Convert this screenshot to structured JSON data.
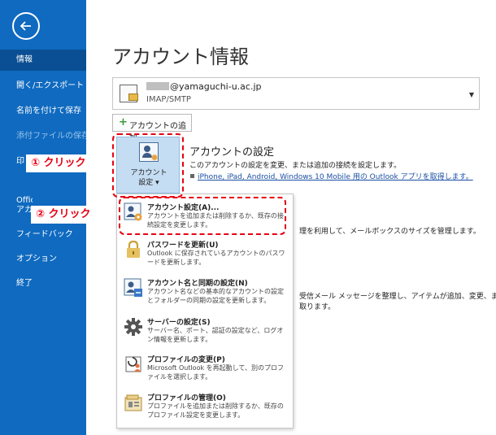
{
  "sidebar": {
    "items": [
      {
        "label": "情報",
        "state": "active"
      },
      {
        "label": "開く/エクスポート"
      },
      {
        "label": "名前を付けて保存"
      },
      {
        "label": "添付ファイルの保存",
        "state": "disabled"
      },
      {
        "label": "印"
      },
      {
        "label": "Office アカ"
      },
      {
        "label": "フィードバック"
      },
      {
        "label": "オプション"
      },
      {
        "label": "終了"
      }
    ]
  },
  "page": {
    "title": "アカウント情報"
  },
  "account": {
    "email": "@yamaguchi-u.ac.jp",
    "type": "IMAP/SMTP"
  },
  "add_account": {
    "label": "アカウントの追加"
  },
  "settings_tile": {
    "label_line1": "アカウント",
    "label_line2": "設定 ▾"
  },
  "section": {
    "title": "アカウントの設定",
    "description": "このアカウントの設定を変更、または追加の接続を設定します。",
    "link": "iPhone, iPad, Android, Windows 10 Mobile 用の Outlook アプリを取得します。"
  },
  "background_text": {
    "line1": "理を利用して、メールボックスのサイズを管理します。",
    "line2": "受信メール メッセージを整理し、アイテムが追加、変更、また",
    "line3": "取ります。"
  },
  "menu": {
    "items": [
      {
        "title": "アカウント設定(A)...",
        "desc": "アカウントを追加または削除するか、既存の接続設定を変更します。",
        "icon": "account-settings-icon"
      },
      {
        "title": "パスワードを更新(U)",
        "desc": "Outlook に保存されているアカウントのパスワードを更新します。",
        "icon": "lock-icon"
      },
      {
        "title": "アカウント名と同期の設定(N)",
        "desc": "アカウント名などの基本的なアカウントの設定とフォルダーの同期の設定を更新します。",
        "icon": "account-sync-icon"
      },
      {
        "title": "サーバーの設定(S)",
        "desc": "サーバー名、ポート、認証の設定など、ログオン情報を更新します。",
        "icon": "gear-icon"
      },
      {
        "title": "プロファイルの変更(P)",
        "desc": "Microsoft Outlook を再起動して、別のプロファイルを選択します。",
        "icon": "profile-change-icon"
      },
      {
        "title": "プロファイルの管理(O)",
        "desc": "プロファイルを追加または削除するか、既存のプロファイル設定を変更します。",
        "icon": "profile-manage-icon"
      }
    ]
  },
  "annotations": {
    "step1": "① クリック",
    "step2": "② クリック"
  },
  "colors": {
    "sidebar": "#0f6ac0",
    "sidebar_active": "#0a4f93",
    "annotation": "#e60012",
    "link": "#1a4fa3"
  }
}
